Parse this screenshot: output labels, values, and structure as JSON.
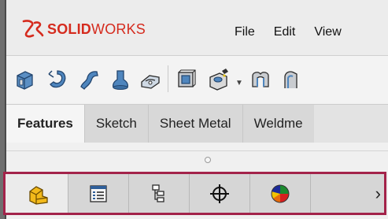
{
  "app": {
    "logo_brand": "SOLID",
    "logo_brand_light": "WORKS"
  },
  "menu": [
    "File",
    "Edit",
    "View"
  ],
  "toolbar": {
    "icons": [
      "extruded-boss-icon",
      "revolved-boss-icon",
      "swept-boss-icon",
      "lofted-boss-icon",
      "boundary-boss-icon",
      "extruded-cut-icon",
      "hole-wizard-icon",
      "dropdown-caret-icon",
      "revolved-cut-icon",
      "swept-cut-icon"
    ]
  },
  "tabs": [
    "Features",
    "Sketch",
    "Sheet Metal",
    "Weldme"
  ],
  "active_tab": "Features",
  "featuremanager_tabs": [
    "feature-tree-icon",
    "property-manager-icon",
    "configuration-manager-icon",
    "dimxpert-icon",
    "display-manager-icon"
  ],
  "more_arrow": "›",
  "colors": {
    "brand_red": "#d52b1e",
    "highlight_border": "#a3234a"
  }
}
